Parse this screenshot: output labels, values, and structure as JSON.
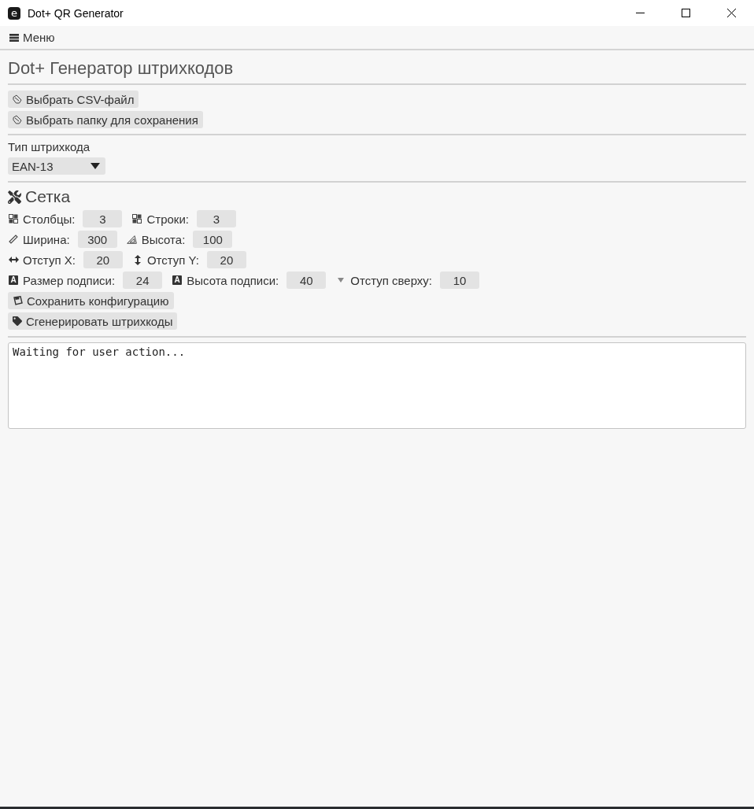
{
  "window": {
    "logo": "e",
    "title": "Dot+ QR Generator"
  },
  "menu": {
    "label": "Меню"
  },
  "heading": "Dot+ Генератор штрихкодов",
  "file_buttons": [
    {
      "label": "Выбрать CSV-файл"
    },
    {
      "label": "Выбрать папку для сохранения"
    }
  ],
  "barcode_type": {
    "label": "Тип штрихкода",
    "value": "EAN-13"
  },
  "grid": {
    "title": "Сетка",
    "rows": [
      [
        {
          "label": "Столбцы:",
          "value": "3"
        },
        {
          "label": "Строки:",
          "value": "3"
        }
      ],
      [
        {
          "label": "Ширина:",
          "value": "300"
        },
        {
          "label": "Высота:",
          "value": "100"
        }
      ],
      [
        {
          "label": "Отступ X:",
          "value": "20"
        },
        {
          "label": "Отступ Y:",
          "value": "20"
        }
      ],
      [
        {
          "label": "Размер подписи:",
          "value": "24",
          "glyph": "A"
        },
        {
          "label": "Высота подписи:",
          "value": "40",
          "glyph": "A"
        },
        {
          "label": "Отступ сверху:",
          "value": "10"
        }
      ]
    ]
  },
  "action_buttons": [
    {
      "label": "Сохранить конфигурацию"
    },
    {
      "label": "Сгенерировать штрихкоды"
    }
  ],
  "log": {
    "value": "Waiting for user action..."
  }
}
